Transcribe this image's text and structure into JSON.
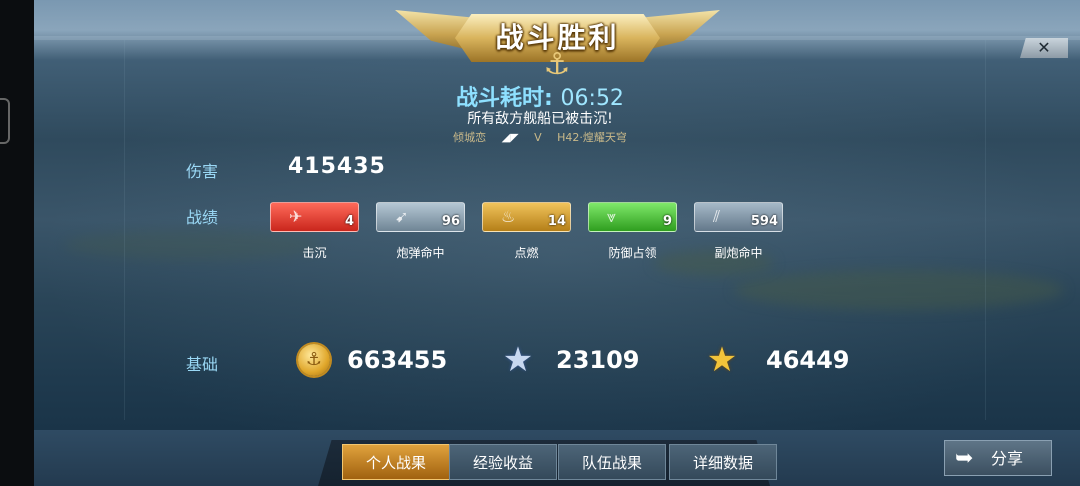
{
  "header": {
    "title": "战斗胜利",
    "close_glyph": "✕"
  },
  "battle": {
    "duration_label": "战斗耗时:",
    "duration_value": "06:52",
    "result": "所有敌方舰船已被击沉!",
    "player_left": "倾城恋",
    "vs": "V",
    "player_right": "H42·煌耀天穹"
  },
  "damage": {
    "label": "伤害",
    "value": "415435"
  },
  "record": {
    "label": "战绩",
    "badges": [
      {
        "label": "击沉",
        "count": "4",
        "icon": "ship-sink-icon",
        "color": "#e0392b"
      },
      {
        "label": "炮弹命中",
        "count": "96",
        "icon": "shell-hit-icon",
        "color": "#8fa3b3"
      },
      {
        "label": "点燃",
        "count": "14",
        "icon": "fire-icon",
        "color": "#d89a2b"
      },
      {
        "label": "防御占领",
        "count": "9",
        "icon": "defend-capture-icon",
        "color": "#4fc53a"
      },
      {
        "label": "副炮命中",
        "count": "594",
        "icon": "secondary-gun-icon",
        "color": "#8196a7"
      }
    ]
  },
  "base": {
    "label": "基础",
    "gold": "663455",
    "silver_star": "23109",
    "gold_star": "46449"
  },
  "tabs": [
    "个人战果",
    "经验收益",
    "队伍战果",
    "详细数据"
  ],
  "share": {
    "label": "分享"
  }
}
